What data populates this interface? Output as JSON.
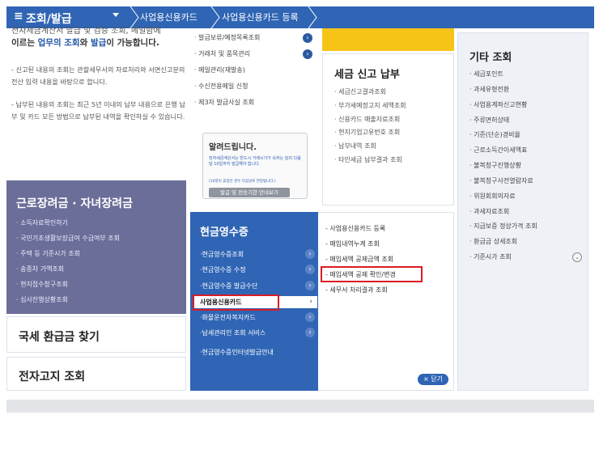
{
  "topbar": {
    "menu_icon": "≡",
    "menu_label": "조회/발급",
    "crumb1": "사업용신용카드",
    "crumb2": "사업용신용카드 등록"
  },
  "intro": {
    "cut_line": "전자세금계산서 발급 및 검증 조회, 메일함에",
    "headline_prefix": "이르는",
    "headline_hl1": "업무의 조회",
    "headline_mid": "와",
    "headline_hl2": "발급",
    "headline_suffix": "이 가능합니다.",
    "para1": "- 신고된 내용의 조회는 관할세무서의 자료처리와 서면신고분의 전산 입력 내용을 바탕으로 합니다.",
    "para2": "- 납부된 내용의 조회는 최근 5년 이내의 납부 내용으로 은행 납부 및 카드 모든 방법으로 납부된 내역을 확인하실 수 있습니다."
  },
  "income_cert": {
    "title": "근로장려금 · 자녀장려금",
    "items": [
      "· 소득자료확인하기",
      "· 국민기초생활보장급여 수급여부 조회",
      "· 주택 등 기준시가 조회",
      "· 송종차 가액조회",
      "· 현지접수창구조회",
      "· 심사진행상황조회"
    ]
  },
  "refund": {
    "label": "국세 환급금 찾기"
  },
  "e_notice": {
    "label": "전자고지 조회"
  },
  "mid_links": [
    "· 발급보류/예정목록조회",
    "· 거래처 및 품목관리",
    "· 메일관리(재발송)",
    "· 수신전용메일 신청",
    "· 제3자 발급사실 조회"
  ],
  "notice": {
    "title": "알려드립니다.",
    "body": "전자세금계산서는 반드시 거래시기가 속하는 달의 다음 달 10일까지 발급해야 합니다.",
    "body2": "(10일이 휴일인 경우 다음날로 연장됩니다.)",
    "button": "발급 및 전송기한 안내보기"
  },
  "tax_report": {
    "title": "세금 신고 납부",
    "items": [
      "· 세금신고결과조회",
      "· 부가세예정고지 세액조회",
      "· 신용카드 매출자료조회",
      "· 현지기업고유번호 조회",
      "· 납부내역 조회",
      "· 타인세금 납부결과 조회"
    ]
  },
  "cash_receipt": {
    "title": "현금영수증",
    "items": [
      "·현금영수증조회",
      "·현금영수증 수정",
      "·현금영수증 발급수단",
      "사업용신용카드",
      "·화물운전자복지카드",
      "·납세관리인 조회 서비스",
      "·현금영수증인터넷발급안내"
    ],
    "selected_chevron": "›"
  },
  "submenu": {
    "items": [
      "- 사업용신용카드 등록",
      "- 매입내역누계 조회",
      "- 매입세액 공제금액 조회",
      "- 매입세액 공제 확인/변경",
      "- 세무서 처리결과 조회"
    ],
    "close": "× 닫기"
  },
  "etc": {
    "title": "기타 조회",
    "items": [
      "· 세금포인트",
      "· 과세유형전환",
      "· 사업용계좌신고현황",
      "· 주류면허상태",
      "· 기준(단순)경비율",
      "· 근로소득간이세액표",
      "· 불복청구진행상황",
      "· 불복청구사전열람자료",
      "· 위원회회의자료",
      "· 과세자료조회",
      "· 지급보증 정상가격 조회",
      "· 환급금 상세조회",
      "· 기준시가 조회"
    ],
    "down_icon": "⌄"
  }
}
